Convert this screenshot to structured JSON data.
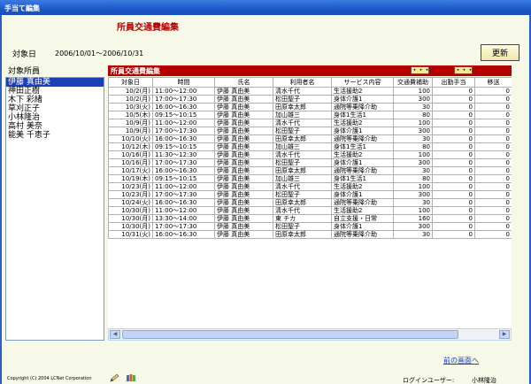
{
  "window": {
    "title": "手当て編集"
  },
  "page": {
    "title": "所員交通費編集"
  },
  "header": {
    "date_label": "対象日",
    "date_range": "2006/10/01～2006/10/31",
    "update_button": "更新"
  },
  "staff": {
    "label": "対象所員",
    "items": [
      "伊藤 真由美",
      "神田正樹",
      "木下 彩緒",
      "草刈正子",
      "小林隆治",
      "高村 美奈",
      "能美 千恵子"
    ]
  },
  "panel": {
    "title": "所員交通費編集",
    "btn1": "・・・",
    "btn2": "・・・"
  },
  "table": {
    "columns": [
      "対象日",
      "時間",
      "氏名",
      "利用者名",
      "サービス内容",
      "交通費補助",
      "出勤手当",
      "移送"
    ],
    "rows": [
      [
        "10/2(月)",
        "11:00～12:00",
        "伊藤 真由美",
        "清水千代",
        "生活援助2",
        "100",
        "0",
        "0"
      ],
      [
        "10/2(月)",
        "17:00～17:30",
        "伊藤 真由美",
        "松田聖子",
        "身体介護1",
        "300",
        "0",
        "0"
      ],
      [
        "10/3(火)",
        "16:00～16:30",
        "伊藤 真由美",
        "田原幸太郎",
        "通院等乗降介助",
        "30",
        "0",
        "0"
      ],
      [
        "10/5(木)",
        "09:15～10:15",
        "伊藤 真由美",
        "加山雄三",
        "身体1生活1",
        "80",
        "0",
        "0"
      ],
      [
        "10/9(月)",
        "11:00～12:00",
        "伊藤 真由美",
        "清水千代",
        "生活援助2",
        "100",
        "0",
        "0"
      ],
      [
        "10/9(月)",
        "17:00～17:30",
        "伊藤 真由美",
        "松田聖子",
        "身体介護1",
        "300",
        "0",
        "0"
      ],
      [
        "10/10(火)",
        "16:00～16:30",
        "伊藤 真由美",
        "田原幸太郎",
        "通院等乗降介助",
        "30",
        "0",
        "0"
      ],
      [
        "10/12(木)",
        "09:15～10:15",
        "伊藤 真由美",
        "加山雄三",
        "身体1生活1",
        "80",
        "0",
        "0"
      ],
      [
        "10/16(月)",
        "11:30～12:30",
        "伊藤 真由美",
        "清水千代",
        "生活援助2",
        "100",
        "0",
        "0"
      ],
      [
        "10/16(月)",
        "17:00～17:30",
        "伊藤 真由美",
        "松田聖子",
        "身体介護1",
        "300",
        "0",
        "0"
      ],
      [
        "10/17(火)",
        "16:00～16:30",
        "伊藤 真由美",
        "田原幸太郎",
        "通院等乗降介助",
        "30",
        "0",
        "0"
      ],
      [
        "10/19(木)",
        "09:15～10:15",
        "伊藤 真由美",
        "加山雄三",
        "身体1生活1",
        "80",
        "0",
        "0"
      ],
      [
        "10/23(月)",
        "11:00～12:00",
        "伊藤 真由美",
        "清水千代",
        "生活援助2",
        "100",
        "0",
        "0"
      ],
      [
        "10/23(月)",
        "17:00～17:30",
        "伊藤 真由美",
        "松田聖子",
        "身体介護1",
        "300",
        "0",
        "0"
      ],
      [
        "10/24(火)",
        "16:00～16:30",
        "伊藤 真由美",
        "田原幸太郎",
        "通院等乗降介助",
        "30",
        "0",
        "0"
      ],
      [
        "10/30(月)",
        "11:00～12:00",
        "伊藤 真由美",
        "清水千代",
        "生活援助2",
        "100",
        "0",
        "0"
      ],
      [
        "10/30(月)",
        "13:30～14:00",
        "伊藤 真由美",
        "東 チカ",
        "自立支援・日常",
        "160",
        "0",
        "0"
      ],
      [
        "10/30(月)",
        "17:00～17:30",
        "伊藤 真由美",
        "松田聖子",
        "身体介護1",
        "300",
        "0",
        "0"
      ],
      [
        "10/31(火)",
        "16:00～16:30",
        "伊藤 真由美",
        "田原幸太郎",
        "通院等乗降介助",
        "30",
        "0",
        "0"
      ]
    ]
  },
  "footer": {
    "back_link": "前の画面へ",
    "copyright": "Copyright (C) 2004 LCNet Corporation",
    "login_label": "ログインユーザー:",
    "login_user": "小林隆治"
  },
  "colors": {
    "title_red": "#b50000",
    "panel_header": "#b30000",
    "selection": "#1c3fb8",
    "background": "#f6f9e8"
  }
}
